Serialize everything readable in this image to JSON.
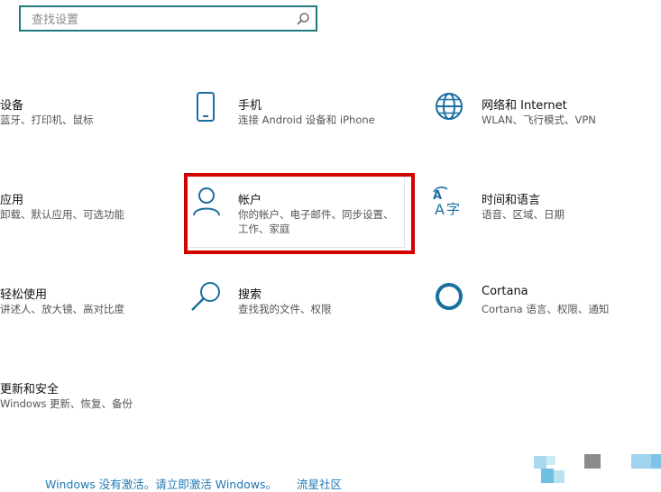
{
  "search": {
    "placeholder": "查找设置"
  },
  "tiles": {
    "devices": {
      "title": "设备",
      "desc": "蓝牙、打印机、鼠标"
    },
    "phone": {
      "title": "手机",
      "desc": "连接 Android 设备和 iPhone"
    },
    "network": {
      "title": "网络和 Internet",
      "desc": "WLAN、飞行模式、VPN"
    },
    "apps": {
      "title": "应用",
      "desc": "卸载、默认应用、可选功能"
    },
    "accounts": {
      "title": "帐户",
      "desc": "你的帐户、电子邮件、同步设置、工作、家庭"
    },
    "time": {
      "title": "时间和语言",
      "desc": "语音、区域、日期"
    },
    "ease": {
      "title": "轻松使用",
      "desc": "讲述人、放大镜、高对比度"
    },
    "search_tile": {
      "title": "搜索",
      "desc": "查找我的文件、权限"
    },
    "cortana": {
      "title": "Cortana",
      "desc": "Cortana 语言、权限、通知"
    },
    "update": {
      "title": "更新和安全",
      "desc": "Windows 更新、恢复、备份"
    }
  },
  "activation": {
    "text": "Windows 没有激活。请立即激活 Windows。",
    "link": "流星社区"
  },
  "colors": {
    "accent": "#1a6fa0",
    "highlight": "#d40000",
    "search_border": "#1f7a7e"
  }
}
